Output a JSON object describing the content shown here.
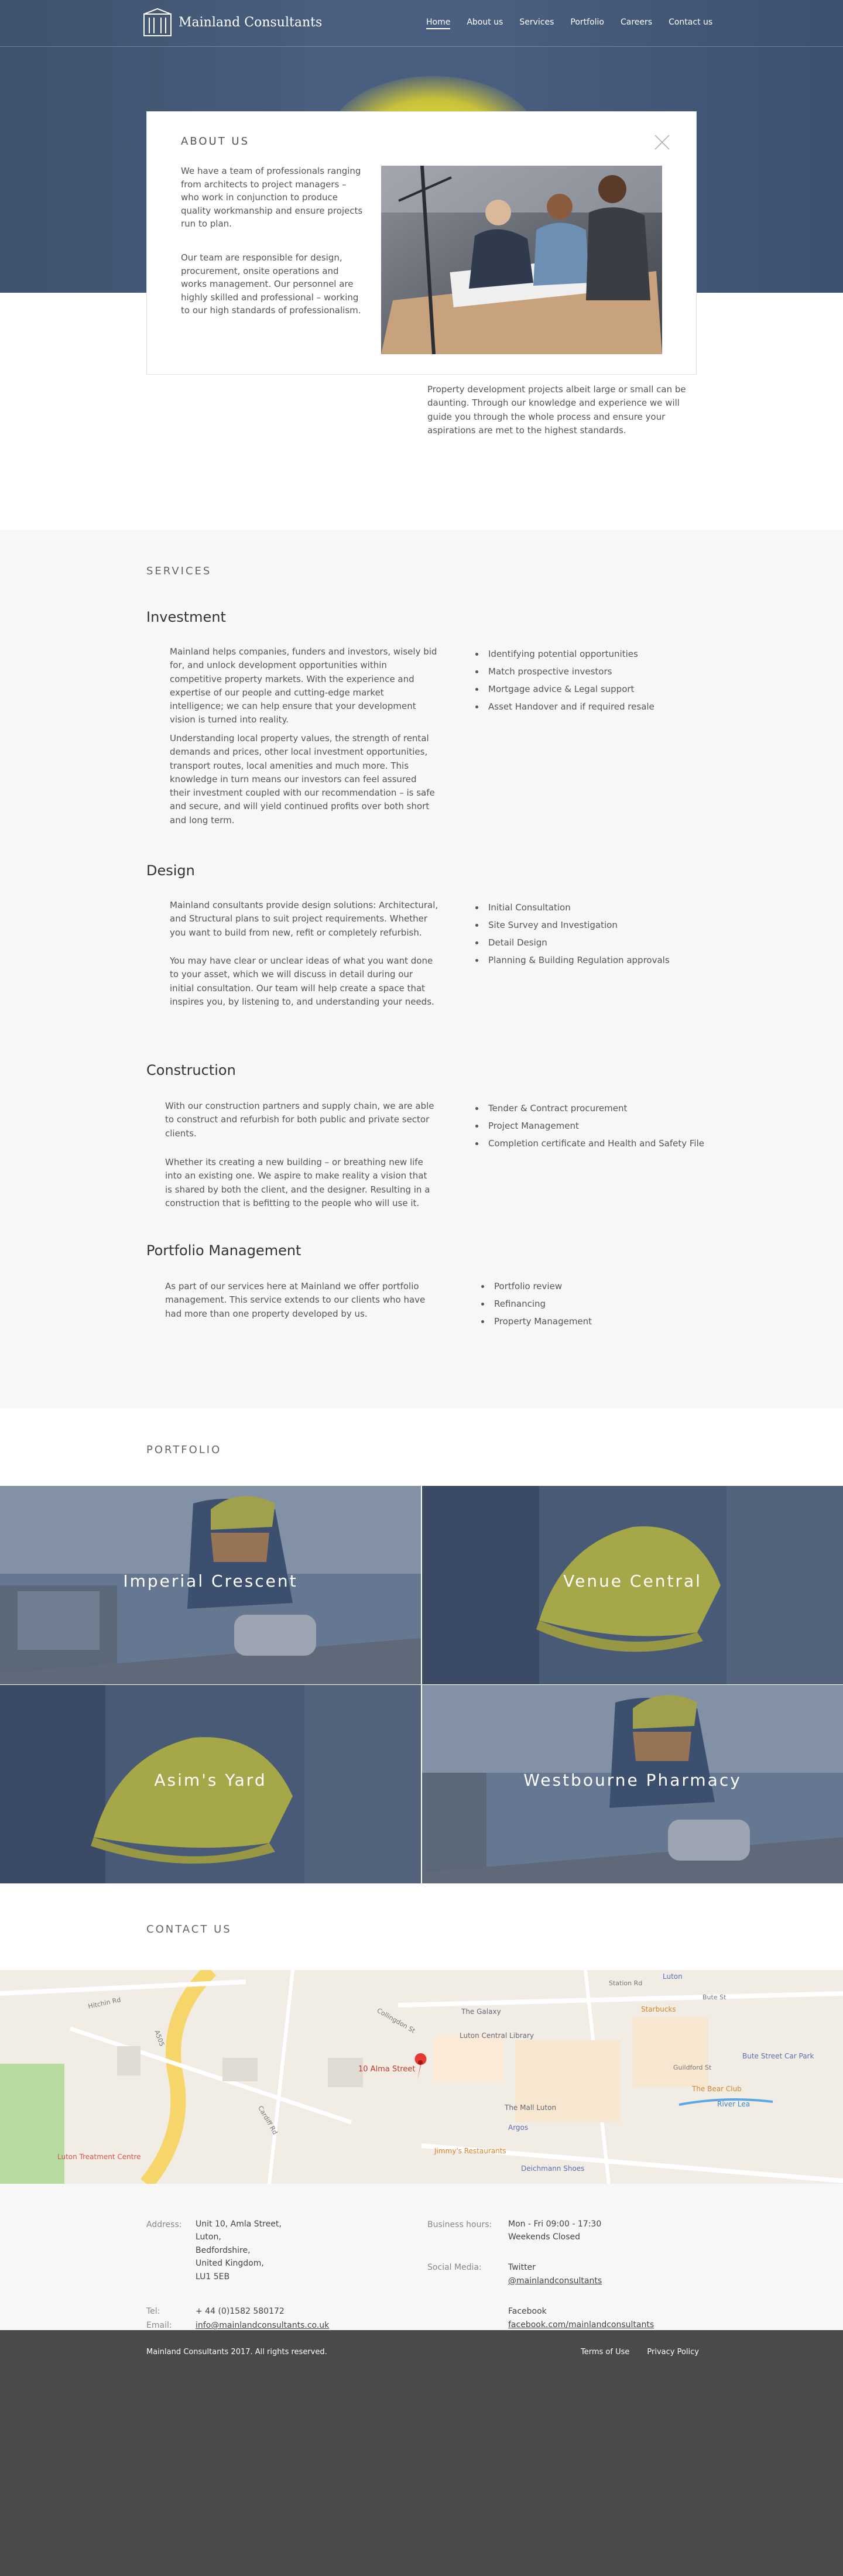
{
  "brand": {
    "name": "Mainland Consultants"
  },
  "nav": {
    "items": [
      "Home",
      "About us",
      "Services",
      "Portfolio",
      "Careers",
      "Contact us"
    ],
    "active": "Home"
  },
  "about": {
    "title": "ABOUT US",
    "p1": "We have a team of professionals ranging from architects to project managers – who work in conjunction to produce quality workmanship and ensure projects run to plan.",
    "p2": "Our team are responsible for design, procurement, onsite operations and works management. Our personnel are highly skilled and professional – working to our high standards of professionalism.",
    "p3": "Property development projects albeit large or small can be daunting. Through our knowledge and experience we will guide you through the whole process and ensure your aspirations are met to the highest standards."
  },
  "services": {
    "title": "SERVICES",
    "investment": {
      "heading": "Investment",
      "p1": "Mainland helps companies, funders and investors, wisely bid for, and unlock development opportunities within competitive property markets. With the experience and expertise of our people and cutting-edge market intelligence; we can help ensure that your development vision is turned into reality.",
      "p2": "Understanding local property values, the strength of rental demands and prices, other local investment opportunities, transport routes, local amenities and much more. This knowledge in turn means our investors can feel assured their investment coupled with our recommendation – is safe and secure, and will yield continued profits over both short and long term.",
      "list": [
        "Identifying potential opportunities",
        "Match prospective investors",
        "Mortgage advice & Legal support",
        "Asset Handover and if required resale"
      ]
    },
    "design": {
      "heading": "Design",
      "p1": "Mainland consultants provide design solutions: Architectural, and Structural plans to suit project requirements. Whether you want to build from new, refit or completely refurbish.",
      "p2": "You may have clear or unclear ideas of what you want done to your asset, which we will discuss in detail during our initial consultation. Our team will help create a space that inspires you, by listening to, and understanding your needs.",
      "list": [
        "Initial Consultation",
        "Site Survey and Investigation",
        "Detail Design",
        "Planning & Building Regulation approvals"
      ]
    },
    "construction": {
      "heading": "Construction",
      "p1": "With our construction partners and supply chain, we are able to construct and refurbish for both public and private sector clients.",
      "p2": "Whether its creating a new building – or breathing new life into an existing one. We aspire to make reality a vision that is shared by both the client, and the designer. Resulting in a construction that is befitting to the people who will use it.",
      "list": [
        "Tender & Contract procurement",
        "Project Management",
        "Completion certificate and Health and Safety File"
      ]
    },
    "portfolio_mgmt": {
      "heading": "Portfolio Management",
      "p1": "As part of our services here at Mainland we offer portfolio management. This service extends to our clients who have had more than one property developed by us.",
      "list": [
        "Portfolio review",
        "Refinancing",
        "Property Management"
      ]
    }
  },
  "portfolio": {
    "title": "PORTFOLIO",
    "tiles": [
      "Imperial Crescent",
      "Venue Central",
      "Asim's Yard",
      "Westbourne Pharmacy"
    ]
  },
  "contact": {
    "title": "CONTACT US",
    "map": {
      "pin_label": "10 Alma Street",
      "places": [
        "The Galaxy",
        "Luton Central Library",
        "The Mall Luton",
        "Starbucks",
        "Bute Street Car Park",
        "The Bear Club",
        "Argos",
        "Jimmy's Restaurants",
        "Deichmann Shoes",
        "Luton Treatment Centre",
        "Luton",
        "River Lea"
      ],
      "streets": [
        "Hitchin Rd",
        "A505",
        "Alma St",
        "Cardiff Rd",
        "Station Rd",
        "Bute St",
        "Guildford St",
        "Collingdon St"
      ]
    },
    "address_label": "Address:",
    "address": [
      "Unit 10, Amla Street,",
      "Luton,",
      "Bedfordshire,",
      "United Kingdom,",
      "LU1 5EB"
    ],
    "tel_label": "Tel:",
    "tel": "+ 44 (0)1582 580172",
    "email_label": "Email:",
    "email": "info@mainlandconsultants.co.uk",
    "hours_label": "Business hours:",
    "hours": [
      "Mon - Fri 09:00 - 17:30",
      "Weekends Closed"
    ],
    "social_label": "Social Media:",
    "twitter_label": "Twitter",
    "twitter": "@mainlandconsultants",
    "facebook_label": "Facebook",
    "facebook": "facebook.com/mainlandconsultants"
  },
  "footer": {
    "copyright": "Mainland Consultants 2017. All rights reserved.",
    "links": [
      "Terms of Use",
      "Privacy Policy"
    ]
  },
  "colors": {
    "hero": "#4a5f80",
    "accent": "#e2dd32",
    "footer": "#4a4a4a",
    "services_bg": "#f7f7f7",
    "map_pin": "#e53935"
  }
}
